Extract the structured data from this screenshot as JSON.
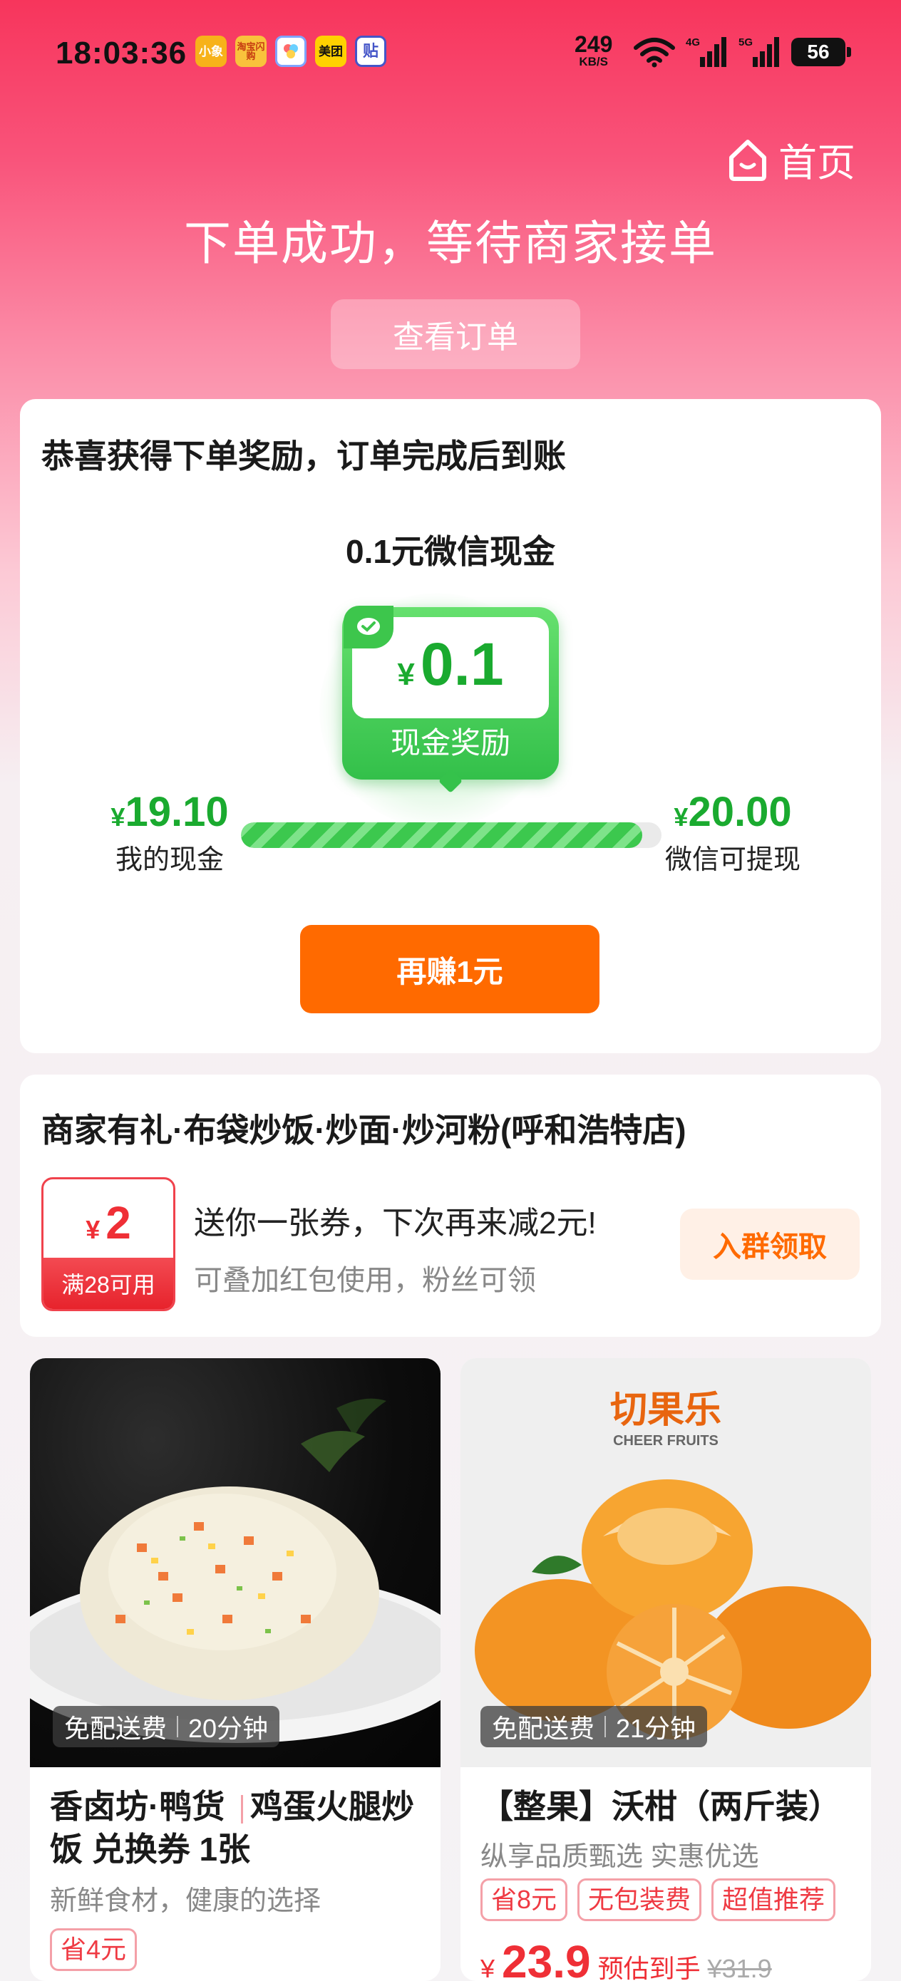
{
  "status_bar": {
    "time": "18:03:36",
    "notif_icons": [
      {
        "label": "小象",
        "name": "xiaoxiang-app-icon"
      },
      {
        "label": "淘宝闪购",
        "name": "taobao-app-icon"
      },
      {
        "label": "",
        "name": "photo-app-icon"
      },
      {
        "label": "美团",
        "name": "meituan-app-icon"
      },
      {
        "label": "贴",
        "name": "tie-app-icon"
      }
    ],
    "net_speed": "249",
    "net_unit": "KB/S",
    "sig1_label": "4G",
    "sig2_label": "5G",
    "battery": "56"
  },
  "header": {
    "home_label": "首页",
    "title": "下单成功，等待商家接单",
    "view_order_label": "查看订单"
  },
  "reward_card": {
    "heading": "恭喜获得下单奖励，订单完成后到账",
    "subtitle": "0.1元微信现金",
    "badge_currency": "¥",
    "badge_amount": "0.1",
    "badge_label": "现金奖励",
    "my_cash_currency": "¥",
    "my_cash_value": "19.10",
    "my_cash_label": "我的现金",
    "withdraw_currency": "¥",
    "withdraw_value": "20.00",
    "withdraw_label": "微信可提现",
    "progress_fraction": 0.955,
    "earn_more_label": "再赚1元"
  },
  "coupon_card": {
    "heading": "商家有礼·布袋炒饭·炒面·炒河粉(呼和浩特店)",
    "ticket_currency": "¥",
    "ticket_amount": "2",
    "ticket_condition": "满28可用",
    "text_main": "送你一张券，下次再来减2元!",
    "text_sub": "可叠加红包使用，粉丝可领",
    "join_label": "入群领取"
  },
  "products": [
    {
      "delivery_free": "免配送费",
      "delivery_time": "20分钟",
      "title_shop": "香卤坊·鸭货",
      "title_item": "鸡蛋火腿炒饭 兑换券 1张",
      "desc": "新鲜食材，健康的选择",
      "tags": [
        "省4元"
      ]
    },
    {
      "brand": "切果乐",
      "brand_en": "CHEER FRUITS",
      "delivery_free": "免配送费",
      "delivery_time": "21分钟",
      "title": "【整果】沃柑（两斤装）",
      "desc": "纵享品质甄选 实惠优选",
      "tags": [
        "省8元",
        "无包装费",
        "超值推荐"
      ],
      "price_currency": "¥",
      "price": "23.9",
      "price_note": "预估到手",
      "orig_price": "¥31.9"
    }
  ],
  "colors": {
    "brand_pink": "#f7355c",
    "reward_green": "#1aaa2f",
    "cta_orange": "#ff6a00",
    "coupon_red": "#ef2f36"
  }
}
